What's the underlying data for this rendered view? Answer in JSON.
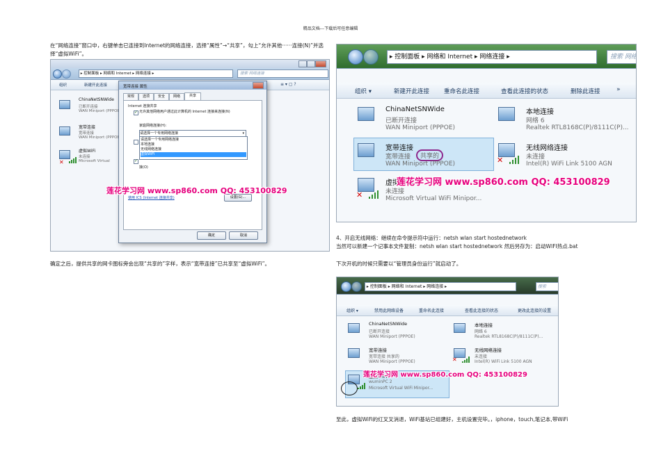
{
  "header": {
    "text": "精品文档---下载后可任意编辑"
  },
  "paragraphs": {
    "p1": "在“网络连接”窗口中，右键单击已连接到Internet的网络连接，选择“属性”→“共享”，勾上“允许其他······连接(N)”并选择“虚拟WiFi”。",
    "p2": "确定之后，提供共享的网卡图标旁会出现“共享的”字样，表示“宽带连接”已共享至“虚拟WiFi”。",
    "p3": "4、开启无线网络：继续在命令提示符中运行：netsh wlan start hostednetwork",
    "p4": "当然可以新建一个记事本文件复制：netsh wlan start hostednetwork  然后另存为：启动WIFI热点.bat",
    "p5": "下次开机的时候只需要以“管理员身份运行”就启动了。",
    "p6": "至此，虚拟WiFi的红叉叉消退，WiFi基站已组建好，主机设置完毕。，iphone，touch,笔记本,带WiFi"
  },
  "watermark": "莲花学习网 www.sp860.com QQ: 453100829",
  "shot1": {
    "breadcrumb": [
      "控制面板",
      "网络和 Internet",
      "网络连接"
    ],
    "search_placeholder": "搜索 网络连接",
    "toolbar": [
      "组织",
      "新建开此连接"
    ],
    "items": [
      {
        "name": "ChinaNetSNWide",
        "sub1": "已断开连接",
        "sub2": "WAN Miniport (PPPOE)",
        "icon": "network-adapter-icon"
      },
      {
        "name": "宽带连接",
        "sub1": "宽带连接",
        "sub2": "WAN Miniport (PPPOE)",
        "icon": "network-adapter-icon"
      },
      {
        "name": "虚拟WiFi",
        "sub1": "未连接",
        "sub2": "Microsoft Virtual",
        "icon": "wireless-adapter-icon"
      }
    ],
    "dialog": {
      "title": "宽带连接 属性",
      "tabs": [
        "常规",
        "选项",
        "安全",
        "网络",
        "共享"
      ],
      "group_title": "Internet 连接共享",
      "check1": "允许其他网络用户通过此计算机的 Internet 连接来连接(N)",
      "home_label": "家庭网络连接(H):",
      "combo_value": "请选择一个专用网络连接",
      "options": [
        "请选择一个专用网络连接",
        "本地连接",
        "无线网络连接",
        "虚拟WiFi"
      ],
      "check3_suffix": "接(O)",
      "link": "使用 ICS (Internet 连接共享)",
      "settings_button": "设置(G)...",
      "ok_button": "确定",
      "cancel_button": "取消"
    },
    "right_tools": "≡ ▾ ▢ ?"
  },
  "shot2": {
    "breadcrumb": [
      "控制面板",
      "网络和 Internet",
      "网络连接"
    ],
    "search_placeholder": "搜索 网络",
    "toolbar": [
      "组织 ▾",
      "新建开此连接",
      "重命名此连接",
      "查看此连接的状态",
      "删除此连接",
      "»"
    ],
    "items": [
      {
        "name": "ChinaNetSNWide",
        "sub1": "已断开连接",
        "sub2": "WAN Miniport (PPPOE)"
      },
      {
        "name": "本地连接",
        "sub1": "网络 6",
        "sub2": "Realtek RTL8168C(P)/8111C(P)..."
      },
      {
        "name": "宽带连接",
        "sub1": "宽带连接",
        "shared": "共享的",
        "sub2": "WAN Miniport (PPPOE)"
      },
      {
        "name": "无线网络连接",
        "sub1": "未连接",
        "sub2": "Intel(R) WiFi Link 5100 AGN"
      },
      {
        "name": "虚拟WiFi",
        "sub1": "未连接",
        "sub2": "Microsoft Virtual WiFi Minipor..."
      }
    ]
  },
  "shot3": {
    "breadcrumb": [
      "控制面板",
      "网络和 Internet",
      "网络连接"
    ],
    "search_placeholder": "搜索",
    "toolbar": [
      "组织 ▾",
      "禁用此网络设备",
      "重命名此连接",
      "查看此连接的状态",
      "更改此连接的设置"
    ],
    "items": [
      {
        "name": "ChinaNetSNWide",
        "sub1": "已断开连接",
        "sub2": "WAN Miniport (PPPOE)"
      },
      {
        "name": "本地连接",
        "sub1": "网络 6",
        "sub2": "Realtek RTL8168C(P)/8111C(P)..."
      },
      {
        "name": "宽带连接",
        "sub1": "宽带连接 共享的",
        "sub2": "WAN Miniport (PPPOE)"
      },
      {
        "name": "无线网络连接",
        "sub1": "未连接",
        "sub2": "Intel(R) WiFi Link 5100 AGN"
      },
      {
        "name": "虚拟WiFi",
        "sub1": "wuminPC  2",
        "sub2": "Microsoft Virtual WiFi Minipor..."
      }
    ]
  }
}
